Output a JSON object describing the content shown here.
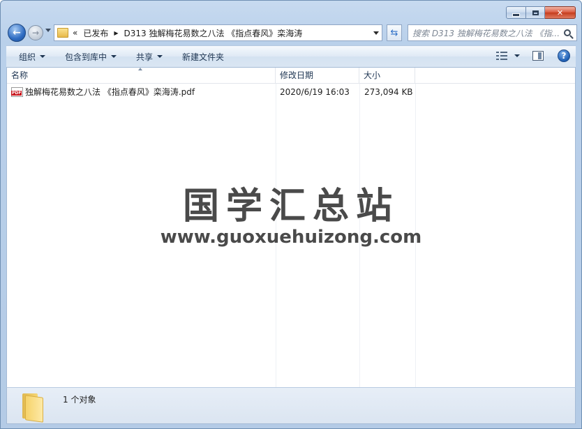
{
  "window": {
    "caption_close": "✕"
  },
  "address": {
    "overflow": "«",
    "parts": [
      "已发布",
      "D313 独解梅花易数之八法 《指点春风》栾海涛"
    ]
  },
  "search": {
    "placeholder": "搜索 D313 独解梅花易数之八法 《指..."
  },
  "toolbar": {
    "organize": "组织",
    "include_in_library": "包含到库中",
    "share": "共享",
    "new_folder": "新建文件夹"
  },
  "columns": {
    "name": "名称",
    "date": "修改日期",
    "size": "大小"
  },
  "files": [
    {
      "name": "独解梅花易数之八法 《指点春风》栾海涛.pdf",
      "date": "2020/6/19 16:03",
      "size": "273,094 KB",
      "icon": "pdf-file-icon",
      "icon_label": "PDF"
    }
  ],
  "watermark": {
    "title": "国学汇总站",
    "url": "www.guoxuehuizong.com"
  },
  "status": {
    "count": "1 个对象"
  },
  "colors": {
    "frame": "#b9d0ea",
    "accent": "#1f5fb4",
    "close": "#c43b1c"
  }
}
